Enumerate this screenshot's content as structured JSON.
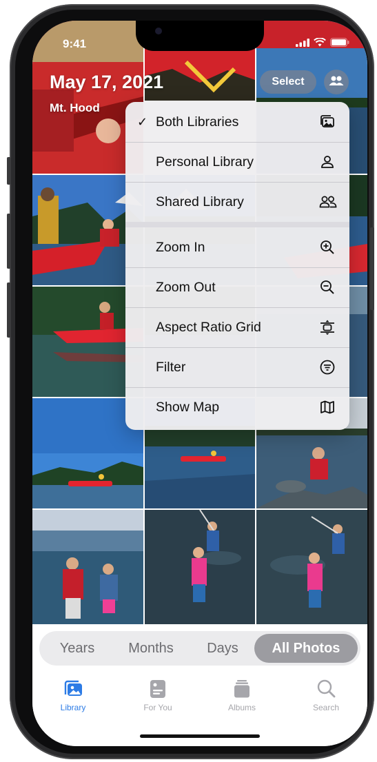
{
  "status_bar": {
    "time": "9:41"
  },
  "header": {
    "date_title": "May 17, 2021",
    "location": "Mt. Hood",
    "select_label": "Select"
  },
  "menu": {
    "items": [
      {
        "label": "Both Libraries",
        "checked": true,
        "icon": "photo-stack-icon"
      },
      {
        "label": "Personal Library",
        "checked": false,
        "icon": "person-icon"
      },
      {
        "label": "Shared Library",
        "checked": false,
        "icon": "two-people-icon"
      },
      {
        "label": "Zoom In",
        "checked": false,
        "icon": "zoom-in-icon"
      },
      {
        "label": "Zoom Out",
        "checked": false,
        "icon": "zoom-out-icon"
      },
      {
        "label": "Aspect Ratio Grid",
        "checked": false,
        "icon": "aspect-ratio-icon"
      },
      {
        "label": "Filter",
        "checked": false,
        "icon": "filter-icon"
      },
      {
        "label": "Show Map",
        "checked": false,
        "icon": "map-icon"
      }
    ],
    "check_glyph": "✓"
  },
  "segmented": {
    "items": [
      "Years",
      "Months",
      "Days",
      "All Photos"
    ],
    "selected": "All Photos"
  },
  "tab_bar": {
    "items": [
      {
        "label": "Library",
        "icon": "library-icon",
        "active": true
      },
      {
        "label": "For You",
        "icon": "for-you-icon",
        "active": false
      },
      {
        "label": "Albums",
        "icon": "albums-icon",
        "active": false
      },
      {
        "label": "Search",
        "icon": "search-icon",
        "active": false
      }
    ]
  },
  "colors": {
    "accent": "#2c7be5",
    "canoe_red": "#d8232f",
    "lake_blue": "#2f5b86",
    "sky_blue": "#3b78c4"
  }
}
